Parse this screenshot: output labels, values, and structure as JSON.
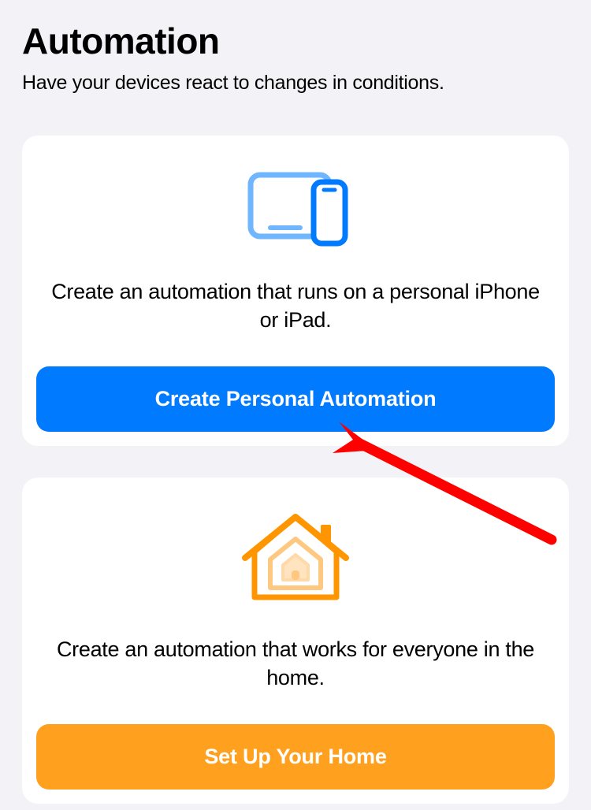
{
  "header": {
    "title": "Automation",
    "subtitle": "Have your devices react to changes in conditions."
  },
  "cards": {
    "personal": {
      "description": "Create an automation that runs on a personal iPhone or iPad.",
      "button_label": "Create Personal Automation",
      "button_color": "#007aff"
    },
    "home": {
      "description": "Create an automation that works for everyone in the home.",
      "button_label": "Set Up Your Home",
      "button_color": "#ffa01e"
    }
  },
  "annotation": {
    "arrow_color": "#ff0000"
  }
}
